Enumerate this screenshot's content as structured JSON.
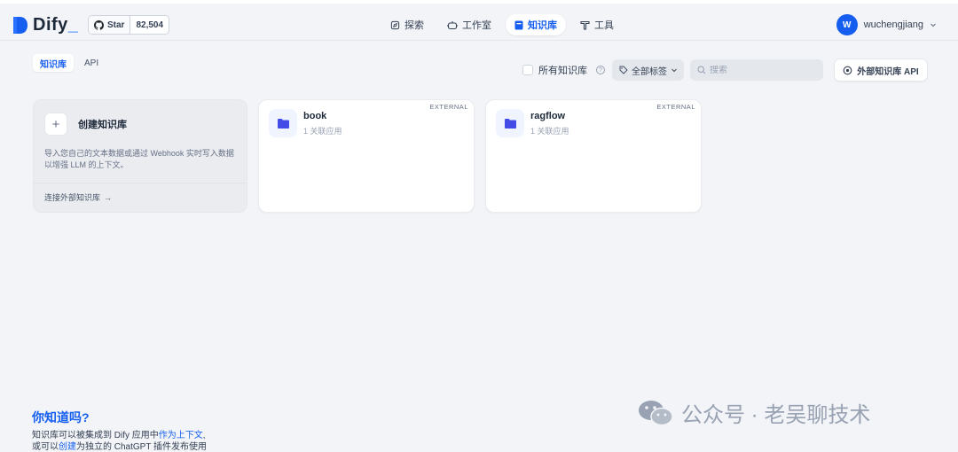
{
  "header": {
    "logo_text": "Dify",
    "star_label": "Star",
    "star_count": "82,504",
    "nav": [
      {
        "label": "探索",
        "icon": "explore-icon",
        "active": false
      },
      {
        "label": "工作室",
        "icon": "robot-icon",
        "active": false
      },
      {
        "label": "知识库",
        "icon": "book-icon",
        "active": true
      },
      {
        "label": "工具",
        "icon": "tool-icon",
        "active": false
      }
    ],
    "user_initial": "W",
    "user_name": "wuchengjiang"
  },
  "subtabs": [
    {
      "label": "知识库",
      "active": true
    },
    {
      "label": "API",
      "active": false
    }
  ],
  "filters": {
    "all_datasets_label": "所有知识库",
    "help_glyph": "?",
    "tags_label": "全部标签",
    "search_placeholder": "搜索",
    "external_api_label": "外部知识库 API"
  },
  "create_card": {
    "plus": "+",
    "title": "创建知识库",
    "description": "导入您自己的文本数据或通过 Webhook 实时写入数据以增强 LLM 的上下文。",
    "link": "连接外部知识库",
    "link_arrow": "→"
  },
  "datasets": [
    {
      "name": "book",
      "meta": "1 关联应用",
      "badge": "EXTERNAL"
    },
    {
      "name": "ragflow",
      "meta": "1 关联应用",
      "badge": "EXTERNAL"
    }
  ],
  "tip": {
    "title": "你知道吗?",
    "line1_pre": "知识库可以被集成到 Dify 应用中",
    "line1_link": "作为上下文",
    "line1_post": ",",
    "line2_pre": "或可以",
    "line2_link": "创建",
    "line2_post": "为独立的 ChatGPT 插件发布使用"
  },
  "watermark": "公众号 · 老吴聊技术",
  "colors": {
    "accent": "#155eef",
    "background": "#f2f4f7",
    "card": "#ffffff"
  }
}
